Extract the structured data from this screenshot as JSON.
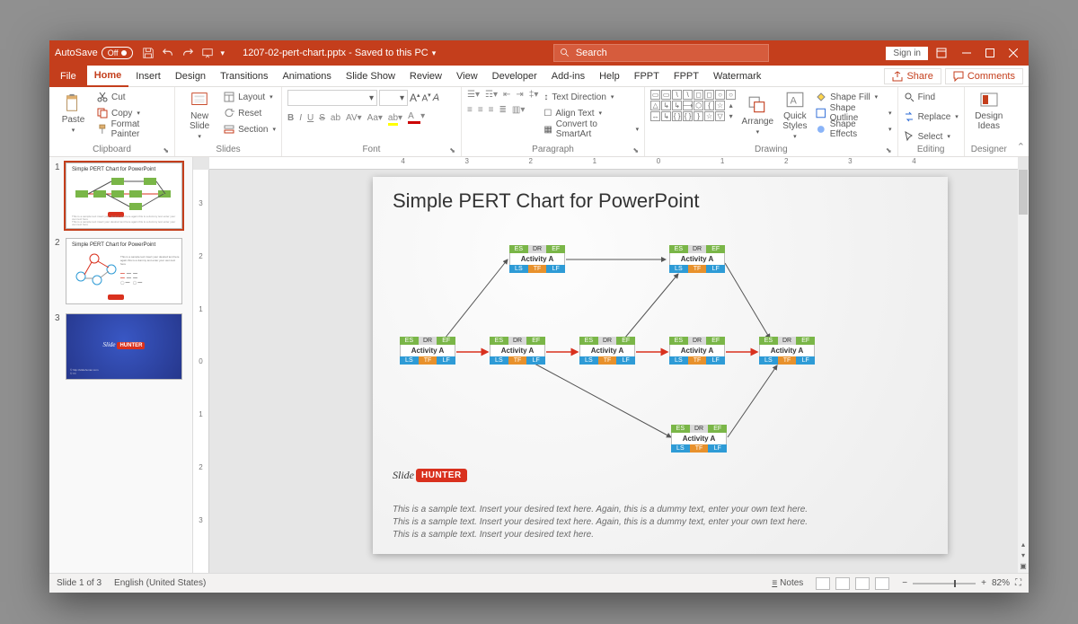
{
  "title": {
    "autosave": "AutoSave",
    "autosave_state": "Off",
    "filename": "1207-02-pert-chart.pptx",
    "saved": "Saved to this PC",
    "search_placeholder": "Search",
    "signin": "Sign in"
  },
  "tabs": {
    "file": "File",
    "list": [
      "Home",
      "Insert",
      "Design",
      "Transitions",
      "Animations",
      "Slide Show",
      "Review",
      "View",
      "Developer",
      "Add-ins",
      "Help",
      "FPPT",
      "FPPT",
      "Watermark"
    ],
    "share": "Share",
    "comments": "Comments"
  },
  "ribbon": {
    "clipboard": {
      "paste": "Paste",
      "cut": "Cut",
      "copy": "Copy",
      "fmt": "Format Painter",
      "label": "Clipboard"
    },
    "slides": {
      "new": "New\nSlide",
      "layout": "Layout",
      "reset": "Reset",
      "section": "Section",
      "label": "Slides"
    },
    "font": {
      "label": "Font",
      "grow": "A",
      "shrink": "A"
    },
    "paragraph": {
      "label": "Paragraph",
      "textdir": "Text Direction",
      "align": "Align Text",
      "convert": "Convert to SmartArt"
    },
    "drawing": {
      "label": "Drawing",
      "arrange": "Arrange",
      "quick": "Quick\nStyles",
      "fill": "Shape Fill",
      "outline": "Shape Outline",
      "effects": "Shape Effects"
    },
    "editing": {
      "label": "Editing",
      "find": "Find",
      "replace": "Replace",
      "select": "Select"
    },
    "designer": {
      "label": "Designer",
      "ideas": "Design\nIdeas"
    }
  },
  "thumbs": [
    {
      "title": "Simple PERT Chart for PowerPoint"
    },
    {
      "title": "Simple PERT Chart for PowerPoint"
    },
    {
      "title": ""
    }
  ],
  "slide": {
    "title": "Simple PERT Chart for PowerPoint",
    "node": {
      "es": "ES",
      "dr": "DR",
      "ef": "EF",
      "act": "Activity A",
      "ls": "LS",
      "tf": "TF",
      "lf": "LF"
    },
    "logo1": "Slide",
    "logo2": "HUNTER",
    "sample1": "This is a sample text. Insert your desired text here. Again, this is a dummy text, enter your own text here.",
    "sample2": "This is a sample text. Insert your desired text here. Again, this is a dummy text, enter your own text here.",
    "sample3": "This is a sample text. Insert your desired text here."
  },
  "status": {
    "slide": "Slide 1 of 3",
    "lang": "English (United States)",
    "notes": "Notes",
    "zoom": "82%"
  }
}
